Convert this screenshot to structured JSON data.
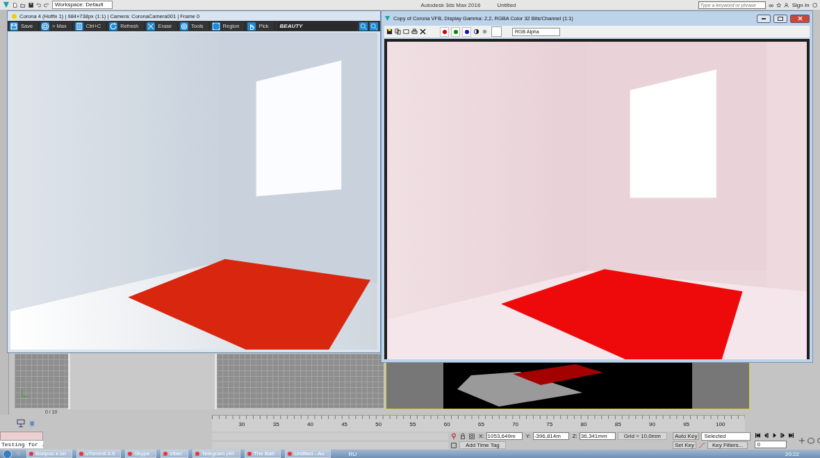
{
  "app": {
    "title": "Autodesk 3ds Max 2016",
    "document": "Untitled",
    "workspace": "Workspace: Default",
    "search": {
      "placeholder": "Type a keyword or phrase"
    },
    "sign_in": "Sign In"
  },
  "render_window": {
    "title": "Corona 4 (Hotfix 1) | 984×738px (1:1) | Camera: CoronaCamera001 | Frame 0",
    "toolbar": [
      {
        "kind": "save",
        "label": "Save"
      },
      {
        "kind": "max",
        "label": "> Max"
      },
      {
        "kind": "copy",
        "label": "Ctrl+C"
      },
      {
        "kind": "refresh",
        "label": "Refresh"
      },
      {
        "kind": "erase",
        "label": "Erase"
      },
      {
        "kind": "tools",
        "label": "Tools"
      },
      {
        "kind": "region",
        "label": "Region"
      },
      {
        "kind": "pick",
        "label": "Pick"
      }
    ],
    "channel": "BEAUTY"
  },
  "vfb_window": {
    "title": "Copy of Corona VFB, Display Gamma: 2,2, RGBA Color 32 Bits/Channel (1:1)",
    "channel_toggles": [
      {
        "color": "#d40000"
      },
      {
        "color": "#008a00"
      },
      {
        "color": "#1010c0"
      }
    ],
    "channel": "RGB Alpha"
  },
  "viewport": {
    "counter": "0 / 10",
    "spinner": "0"
  },
  "timeline": {
    "ticks": [
      "30",
      "35",
      "40",
      "45",
      "50",
      "55",
      "60",
      "65",
      "70",
      "75",
      "80",
      "85",
      "90",
      "95",
      "100"
    ]
  },
  "listener": {
    "text": "Testing for ."
  },
  "status": {
    "coords": [
      {
        "label": "X:",
        "value": "1053,649m"
      },
      {
        "label": "Y:",
        "value": "-396,814m"
      },
      {
        "label": "Z:",
        "value": "36,341mm"
      }
    ],
    "grid": "Grid = 10,0mm",
    "add_time_tag": "Add Time Tag",
    "auto_key": "Auto Key",
    "set_key": "Set Key",
    "key_mode": "Selected",
    "key_filters": "Key Filters...",
    "frame": "0"
  },
  "taskbar": {
    "items": [
      {
        "label": "Вопрос к оп"
      },
      {
        "label": "uTorrent 3.5"
      },
      {
        "label": "Skype"
      },
      {
        "label": "Viber"
      },
      {
        "label": "Telegram (40"
      },
      {
        "label": "The Bat!"
      },
      {
        "label": "Untitled - Au"
      }
    ],
    "language": "RU",
    "clock": "20:22"
  }
}
